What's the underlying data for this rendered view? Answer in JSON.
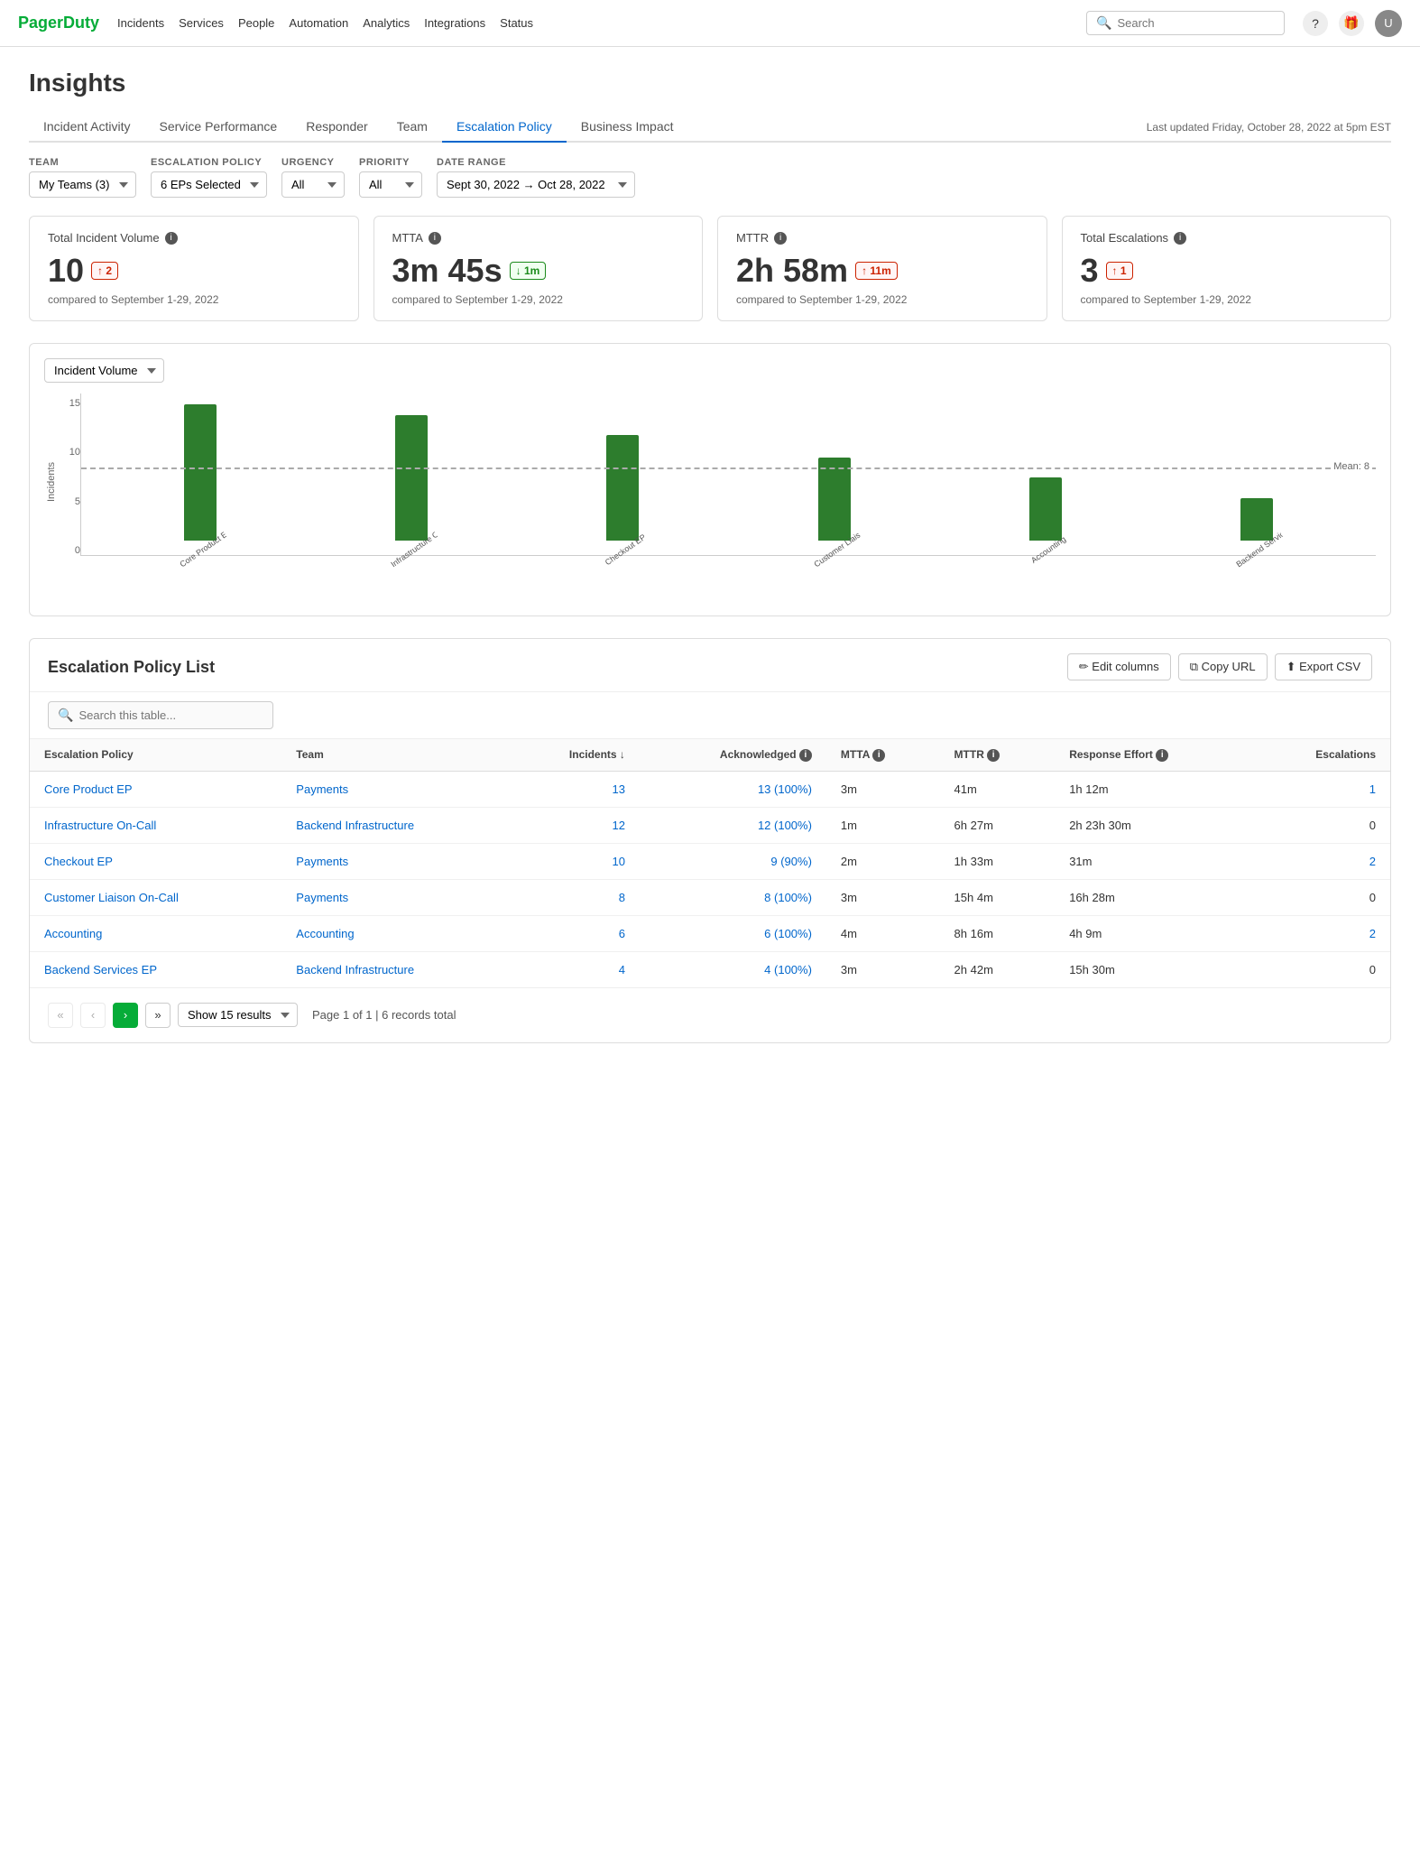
{
  "nav": {
    "logo": "PagerDuty",
    "links": [
      "Incidents",
      "Services",
      "People",
      "Automation",
      "Analytics",
      "Integrations",
      "Status"
    ],
    "search_placeholder": "Search"
  },
  "page": {
    "title": "Insights",
    "last_updated": "Last updated Friday, October 28, 2022 at 5pm EST"
  },
  "tabs": [
    {
      "id": "incident-activity",
      "label": "Incident Activity"
    },
    {
      "id": "service-performance",
      "label": "Service Performance"
    },
    {
      "id": "responder",
      "label": "Responder"
    },
    {
      "id": "team",
      "label": "Team"
    },
    {
      "id": "escalation-policy",
      "label": "Escalation Policy",
      "active": true
    },
    {
      "id": "business-impact",
      "label": "Business Impact"
    }
  ],
  "filters": {
    "team": {
      "label": "TEAM",
      "value": "My Teams (3)"
    },
    "escalation_policy": {
      "label": "ESCALATION POLICY",
      "value": "6 EPs Selected"
    },
    "urgency": {
      "label": "URGENCY",
      "value": "All"
    },
    "priority": {
      "label": "PRIORITY",
      "value": "All"
    },
    "date_range": {
      "label": "DATE RANGE",
      "value": "Sept 30, 2022 → Oct 28, 2022"
    }
  },
  "metrics": [
    {
      "title": "Total Incident Volume",
      "value": "10",
      "badge": "↑ 2",
      "badge_type": "red",
      "compare": "compared to September 1-29, 2022"
    },
    {
      "title": "MTTA",
      "value": "3m 45s",
      "badge": "↓ 1m",
      "badge_type": "green",
      "compare": "compared to September 1-29, 2022"
    },
    {
      "title": "MTTR",
      "value": "2h 58m",
      "badge": "↑ 11m",
      "badge_type": "red",
      "compare": "compared to September 1-29, 2022"
    },
    {
      "title": "Total Escalations",
      "value": "3",
      "badge": "↑ 1",
      "badge_type": "red",
      "compare": "compared to September 1-29, 2022"
    }
  ],
  "chart": {
    "title": "Incident Volume",
    "mean": 8,
    "mean_label": "Mean: 8",
    "y_axis_label": "Incidents",
    "y_max": 15,
    "bars": [
      {
        "label": "Core Product EP",
        "value": 13,
        "height_pct": 87
      },
      {
        "label": "Infrastructure O...",
        "value": 12,
        "height_pct": 80
      },
      {
        "label": "Checkout EP",
        "value": 10,
        "height_pct": 67
      },
      {
        "label": "Customer Liaison...",
        "value": 8,
        "height_pct": 53
      },
      {
        "label": "Accounting",
        "value": 6,
        "height_pct": 40
      },
      {
        "label": "Backend Services...",
        "value": 4,
        "height_pct": 27
      }
    ]
  },
  "table": {
    "title": "Escalation Policy List",
    "search_placeholder": "Search this table...",
    "columns": [
      {
        "id": "ep",
        "label": "Escalation Policy"
      },
      {
        "id": "team",
        "label": "Team"
      },
      {
        "id": "incidents",
        "label": "Incidents ↓",
        "right": true
      },
      {
        "id": "acknowledged",
        "label": "Acknowledged",
        "right": true
      },
      {
        "id": "mtta",
        "label": "MTTA",
        "right": false
      },
      {
        "id": "mttr",
        "label": "MTTR",
        "right": false
      },
      {
        "id": "response_effort",
        "label": "Response Effort",
        "right": false
      },
      {
        "id": "escalations",
        "label": "Escalations",
        "right": true
      }
    ],
    "rows": [
      {
        "ep": "Core Product EP",
        "team": "Payments",
        "incidents": "13",
        "acknowledged": "13 (100%)",
        "mtta": "3m",
        "mttr": "41m",
        "response_effort": "1h 12m",
        "escalations": "1",
        "escalations_link": true
      },
      {
        "ep": "Infrastructure On-Call",
        "team": "Backend Infrastructure",
        "incidents": "12",
        "acknowledged": "12 (100%)",
        "mtta": "1m",
        "mttr": "6h 27m",
        "response_effort": "2h 23h 30m",
        "escalations": "0",
        "escalations_link": false
      },
      {
        "ep": "Checkout EP",
        "team": "Payments",
        "incidents": "10",
        "acknowledged": "9 (90%)",
        "mtta": "2m",
        "mttr": "1h 33m",
        "response_effort": "31m",
        "escalations": "2",
        "escalations_link": true
      },
      {
        "ep": "Customer Liaison On-Call",
        "team": "Payments",
        "incidents": "8",
        "acknowledged": "8 (100%)",
        "mtta": "3m",
        "mttr": "15h 4m",
        "response_effort": "16h 28m",
        "escalations": "0",
        "escalations_link": false
      },
      {
        "ep": "Accounting",
        "team": "Accounting",
        "incidents": "6",
        "acknowledged": "6 (100%)",
        "mtta": "4m",
        "mttr": "8h 16m",
        "response_effort": "4h 9m",
        "escalations": "2",
        "escalations_link": true
      },
      {
        "ep": "Backend Services EP",
        "team": "Backend Infrastructure",
        "incidents": "4",
        "acknowledged": "4 (100%)",
        "mtta": "3m",
        "mttr": "2h 42m",
        "response_effort": "15h 30m",
        "escalations": "0",
        "escalations_link": false
      }
    ],
    "buttons": {
      "edit_columns": "✏ Edit columns",
      "copy_url": "⧉ Copy URL",
      "export_csv": "⬆ Export CSV"
    }
  },
  "pagination": {
    "show_results_label": "Show 15 results",
    "page_info": "Page 1 of 1 | 6 records total"
  }
}
